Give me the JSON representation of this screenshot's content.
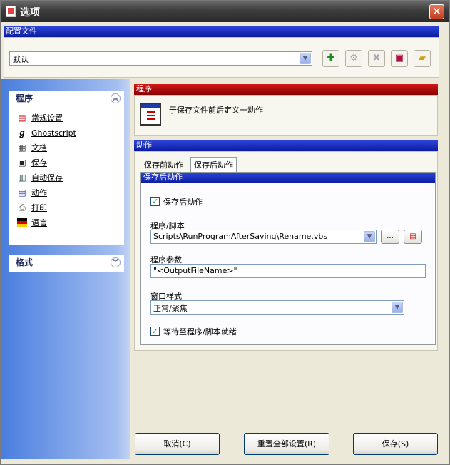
{
  "window": {
    "title": "选项",
    "close_glyph": "✕"
  },
  "profile": {
    "header": "配置文件",
    "selected": "默认",
    "toolbar_icons": [
      "add-icon",
      "settings-disabled-icon",
      "delete-disabled-icon",
      "save-icon",
      "open-folder-icon"
    ]
  },
  "sidebar": {
    "program_header": "程序",
    "format_header": "格式",
    "items": [
      {
        "label": "常规设置",
        "icon": "general-settings-icon"
      },
      {
        "label": "Ghostscript",
        "icon": "ghostscript-icon"
      },
      {
        "label": "文档",
        "icon": "document-icon"
      },
      {
        "label": "保存",
        "icon": "save-icon"
      },
      {
        "label": "自动保存",
        "icon": "autosave-icon"
      },
      {
        "label": "动作",
        "icon": "action-icon"
      },
      {
        "label": "打印",
        "icon": "print-icon"
      },
      {
        "label": "语言",
        "icon": "language-icon"
      }
    ]
  },
  "program_section": {
    "header": "程序",
    "description": "于保存文件前后定义一动作"
  },
  "action_section": {
    "header": "动作",
    "tabs": [
      "保存前动作",
      "保存后动作"
    ],
    "active_tab": "保存后动作",
    "panel_header": "保存后动作",
    "save_after_checkbox_label": "保存后动作",
    "program_script_label": "程序/脚本",
    "program_script_value": "Scripts\\RunProgramAfterSaving\\Rename.vbs",
    "browse_label": "...",
    "program_params_label": "程序参数",
    "program_params_value": "\"<OutputFileName>\"",
    "window_style_label": "窗口样式",
    "window_style_value": "正常/聚焦",
    "wait_checkbox_label": "等待至程序/脚本就绪"
  },
  "buttons": {
    "cancel": "取消(C)",
    "reset_all": "重置全部设置(R)",
    "save": "保存(S)"
  },
  "colors": {
    "blue_header": "#1a2fc8",
    "red_header": "#b00000",
    "sidebar_blue": "#4a7ede"
  }
}
